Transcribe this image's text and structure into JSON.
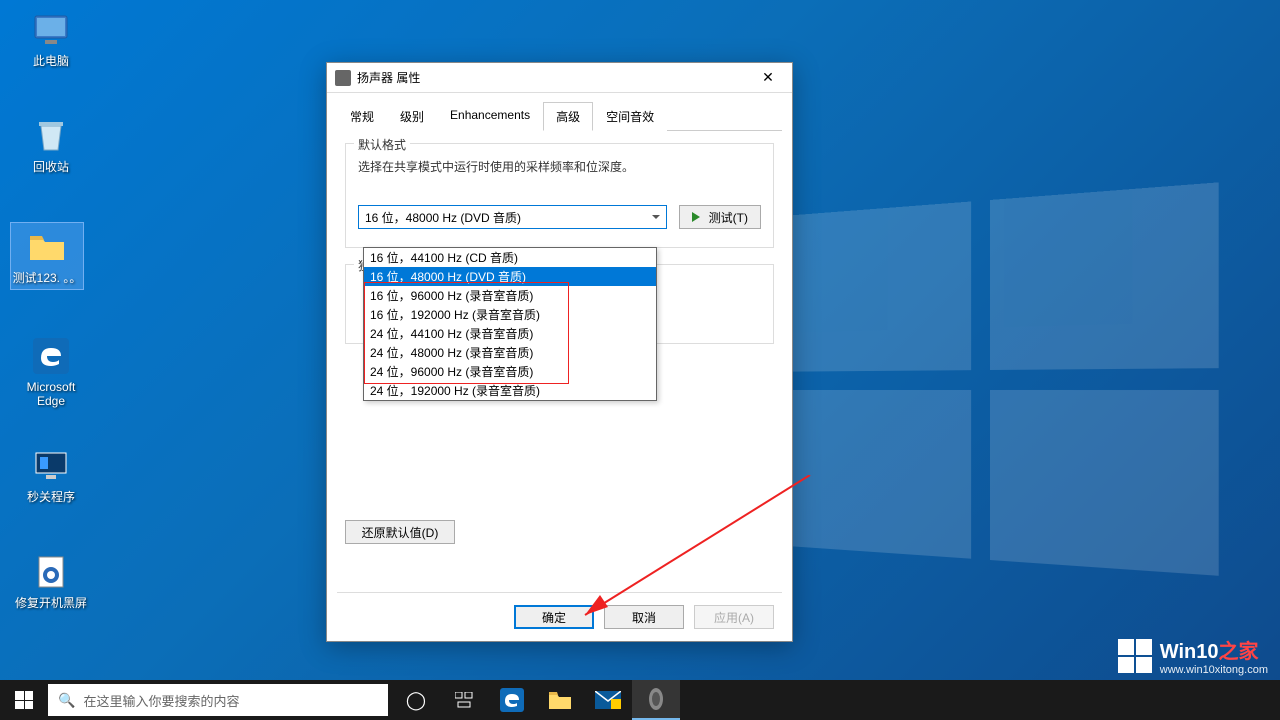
{
  "desktop": {
    "icons": [
      {
        "name": "this-pc",
        "label": "此电脑"
      },
      {
        "name": "recycle-bin",
        "label": "回收站"
      },
      {
        "name": "folder-test",
        "label": "测试123. 。。"
      },
      {
        "name": "edge",
        "label": "Microsoft Edge"
      },
      {
        "name": "sec-close",
        "label": "秒关程序"
      },
      {
        "name": "fix-boot",
        "label": "修复开机黑屏"
      }
    ]
  },
  "dialog": {
    "title": "扬声器 属性",
    "tabs": [
      "常规",
      "级别",
      "Enhancements",
      "高级",
      "空间音效"
    ],
    "active_tab": "高级",
    "group1": {
      "legend": "默认格式",
      "desc": "选择在共享模式中运行时使用的采样频率和位深度。",
      "selected": "16 位，48000 Hz (DVD 音质)",
      "test_btn": "测试(T)",
      "options": [
        "16 位，44100 Hz (CD 音质)",
        "16 位，48000 Hz (DVD 音质)",
        "16 位，96000 Hz (录音室音质)",
        "16 位，192000 Hz (录音室音质)",
        "24 位，44100 Hz (录音室音质)",
        "24 位，48000 Hz (录音室音质)",
        "24 位，96000 Hz (录音室音质)",
        "24 位，192000 Hz (录音室音质)"
      ],
      "selected_index": 1
    },
    "group2": {
      "legend": "独"
    },
    "restore_btn": "还原默认值(D)",
    "buttons": {
      "ok": "确定",
      "cancel": "取消",
      "apply": "应用(A)"
    }
  },
  "taskbar": {
    "search_placeholder": "在这里输入你要搜索的内容"
  },
  "watermark": {
    "line1a": "Win10",
    "line1b": "之家",
    "line2": "www.win10xitong.com"
  }
}
